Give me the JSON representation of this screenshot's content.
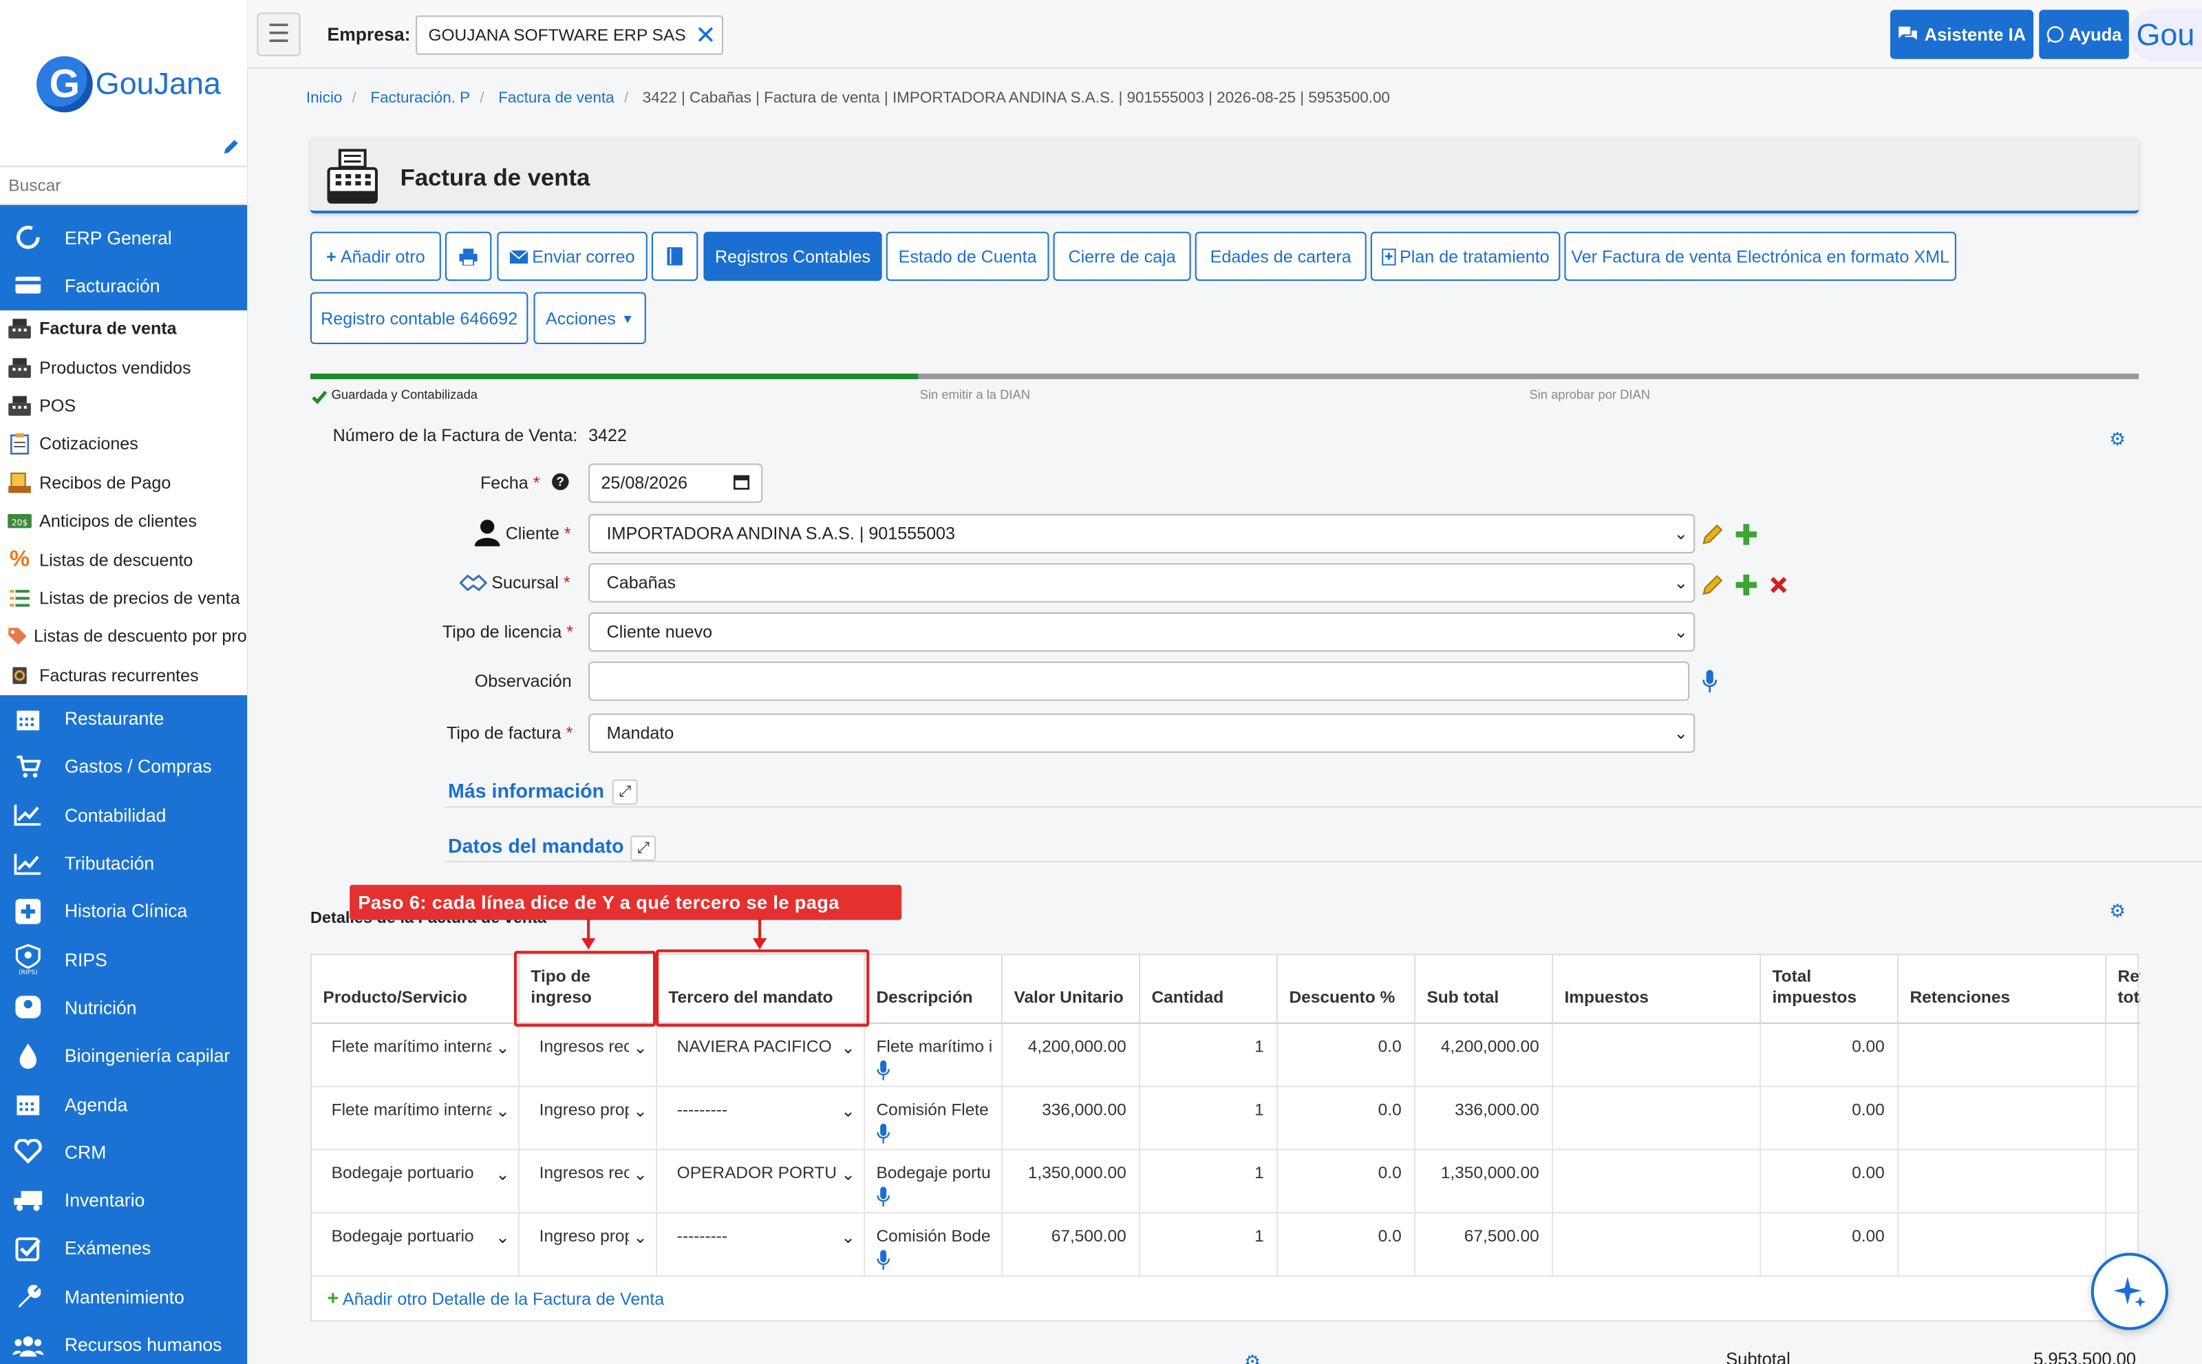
{
  "topbar": {
    "empresa_label": "Empresa:",
    "empresa_value": "GOUJANA SOFTWARE ERP SAS",
    "asistente_label": "Asistente IA",
    "ayuda_label": "Ayuda",
    "avatar_text": "Gou"
  },
  "logo": {
    "mark": "G",
    "text": "GouJana"
  },
  "search": {
    "placeholder": "Buscar"
  },
  "sidebar": {
    "top_items": [
      {
        "label": "ERP General",
        "icon": "circle-notch-icon"
      },
      {
        "label": "Facturación",
        "icon": "credit-card-icon"
      }
    ],
    "sub_items": [
      {
        "label": "Factura de venta",
        "icon": "cash-register-icon",
        "active": true
      },
      {
        "label": "Productos vendidos",
        "icon": "cash-register-icon"
      },
      {
        "label": "POS",
        "icon": "cash-register-icon"
      },
      {
        "label": "Cotizaciones",
        "icon": "clipboard-icon"
      },
      {
        "label": "Recibos de Pago",
        "icon": "receipt-icon"
      },
      {
        "label": "Anticipos de clientes",
        "icon": "banknote-icon"
      },
      {
        "label": "Listas de descuento",
        "icon": "percent-icon"
      },
      {
        "label": "Listas de precios de venta",
        "icon": "list-icon"
      },
      {
        "label": "Listas de descuento por prod",
        "icon": "tag-icon"
      },
      {
        "label": "Facturas recurrentes",
        "icon": "recurring-icon"
      }
    ],
    "bottom_items": [
      {
        "label": "Restaurante",
        "icon": "calendar-icon"
      },
      {
        "label": "Gastos / Compras",
        "icon": "cart-icon"
      },
      {
        "label": "Contabilidad",
        "icon": "chart-line-icon"
      },
      {
        "label": "Tributación",
        "icon": "chart-line-icon"
      },
      {
        "label": "Historia Clínica",
        "icon": "plus-square-icon"
      },
      {
        "label": "RIPS",
        "icon": "rips-icon",
        "badge": "RIPS"
      },
      {
        "label": "Nutrición",
        "icon": "scale-icon"
      },
      {
        "label": "Bioingeniería capilar",
        "icon": "drop-icon"
      },
      {
        "label": "Agenda",
        "icon": "calendar-icon"
      },
      {
        "label": "CRM",
        "icon": "heart-icon"
      },
      {
        "label": "Inventario",
        "icon": "truck-icon"
      },
      {
        "label": "Exámenes",
        "icon": "check-square-icon"
      },
      {
        "label": "Mantenimiento",
        "icon": "wrench-icon"
      },
      {
        "label": "Recursos humanos",
        "icon": "users-icon"
      }
    ]
  },
  "breadcrumb": [
    "Inicio",
    "Facturación. P",
    "Factura de venta",
    "3422 | Cabañas | Factura de venta | IMPORTADORA ANDINA S.A.S. | 901555003 | 2026-08-25 | 5953500.00"
  ],
  "page_title": "Factura de venta",
  "actions": {
    "anadir": "Añadir otro",
    "enviar": "Enviar correo",
    "registros": "Registros Contables",
    "estado": "Estado de Cuenta",
    "cierre": "Cierre de caja",
    "edades": "Edades de cartera",
    "plan": "Plan de tratamiento",
    "xml": "Ver Factura de venta Electrónica en formato XML",
    "registro_contable": "Registro contable 646692",
    "acciones": "Acciones"
  },
  "progress": {
    "steps": [
      "Guardada y Contabilizada",
      "Sin emitir a la DIAN",
      "Sin aprobar por DIAN"
    ],
    "completed": 1
  },
  "form": {
    "numero_label": "Número de la Factura de Venta:",
    "numero_value": "3422",
    "fecha_label": "Fecha",
    "fecha_value": "25/08/2026",
    "cliente_label": "Cliente",
    "cliente_value": "IMPORTADORA ANDINA S.A.S. | 901555003",
    "sucursal_label": "Sucursal",
    "sucursal_value": "Cabañas",
    "licencia_label": "Tipo de licencia",
    "licencia_value": "Cliente nuevo",
    "observacion_label": "Observación",
    "observacion_value": "",
    "tipo_factura_label": "Tipo de factura",
    "tipo_factura_value": "Mandato",
    "req_mark": "*"
  },
  "sections": {
    "mas_info": "Más información",
    "datos_mandato": "Datos del mandato",
    "detalles": "Detalles de la Factura de venta"
  },
  "callout": "Paso 6: cada línea dice de Y a qué tercero se le paga",
  "table": {
    "headers": [
      "Producto/Servicio",
      "Tipo de ingreso",
      "Tercero del mandato",
      "Descripción",
      "Valor Unitario",
      "Cantidad",
      "Descuento %",
      "Sub total",
      "Impuestos",
      "Total impuestos",
      "Retenciones",
      "Ret tota"
    ],
    "rows": [
      {
        "producto": "Flete marítimo internacional",
        "tipo": "Ingresos recibidos",
        "tercero": "NAVIERA PACIFICO SAS",
        "desc": "Flete marítimo i",
        "valor": "4,200,000.00",
        "cantidad": "1",
        "descuento": "0.0",
        "subtotal": "4,200,000.00",
        "impuestos": "",
        "total_imp": "0.00"
      },
      {
        "producto": "Flete marítimo internacional",
        "tipo": "Ingreso propio",
        "tercero": "---------",
        "desc": "Comisión Flete",
        "valor": "336,000.00",
        "cantidad": "1",
        "descuento": "0.0",
        "subtotal": "336,000.00",
        "impuestos": "",
        "total_imp": "0.00"
      },
      {
        "producto": "Bodegaje portuario",
        "tipo": "Ingresos recibidos",
        "tercero": "OPERADOR PORTUARIO",
        "desc": "Bodegaje portu",
        "valor": "1,350,000.00",
        "cantidad": "1",
        "descuento": "0.0",
        "subtotal": "1,350,000.00",
        "impuestos": "",
        "total_imp": "0.00"
      },
      {
        "producto": "Bodegaje portuario",
        "tipo": "Ingreso propio",
        "tercero": "---------",
        "desc": "Comisión Bode",
        "valor": "67,500.00",
        "cantidad": "1",
        "descuento": "0.0",
        "subtotal": "67,500.00",
        "impuestos": "",
        "total_imp": "0.00"
      }
    ],
    "add_row": "Añadir otro Detalle de la Factura de Venta"
  },
  "totals": {
    "subtotal_label": "Subtotal",
    "subtotal_value": "5,953,500.00"
  },
  "colors": {
    "accent": "#1a73d4",
    "primary": "#1a6fd1",
    "success": "#1e8c2a",
    "danger": "#e53030"
  }
}
